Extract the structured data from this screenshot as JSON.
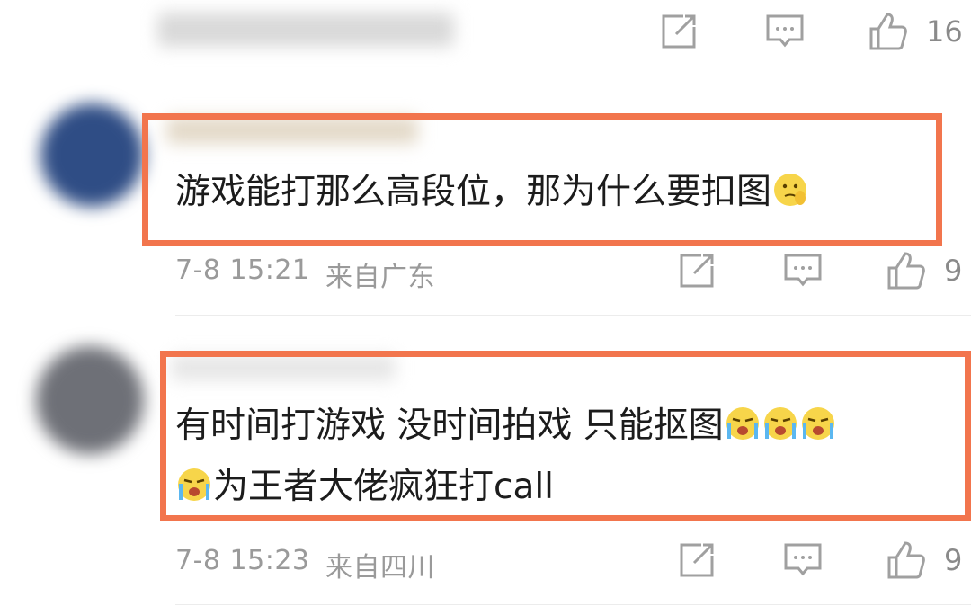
{
  "prev_comment": {
    "likes": "16"
  },
  "comments": [
    {
      "text": "游戏能打那么高段位，那为什么要扣图",
      "time": "7-8 15:21",
      "location": "来自广东",
      "likes": "9",
      "emoji": "saluting-face"
    },
    {
      "text_line1": "有时间打游戏 没时间拍戏 只能抠图",
      "text_line2": "为王者大佬疯狂打call",
      "time": "7-8 15:23",
      "location": "来自四川",
      "likes": "9",
      "emoji": "crying-face"
    }
  ],
  "colors": {
    "highlight": "#f2754d",
    "meta": "#9a9a9a",
    "icon": "#a0a0a0"
  }
}
